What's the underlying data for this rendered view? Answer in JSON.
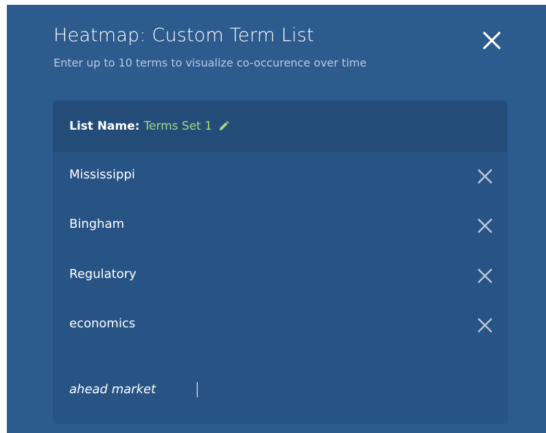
{
  "modal": {
    "title": "Heatmap: Custom Term List",
    "subtitle": "Enter up to 10 terms to visualize co-occurence over time",
    "close_icon": "close-icon"
  },
  "list": {
    "name_label": "List Name:",
    "name_value": "Terms Set 1",
    "edit_icon": "pencil-icon",
    "terms": [
      {
        "text": "Mississippi",
        "remove_icon": "close-icon"
      },
      {
        "text": "Bingham",
        "remove_icon": "close-icon"
      },
      {
        "text": "Regulatory",
        "remove_icon": "close-icon"
      },
      {
        "text": "economics",
        "remove_icon": "close-icon"
      }
    ],
    "input_value": "ahead market"
  },
  "colors": {
    "modal_background": "#2d5b8e",
    "panel_background": "#285485",
    "panel_header_background": "#234c79",
    "list_name_accent": "#a8d67a",
    "remove_icon": "#b7c6d8"
  }
}
